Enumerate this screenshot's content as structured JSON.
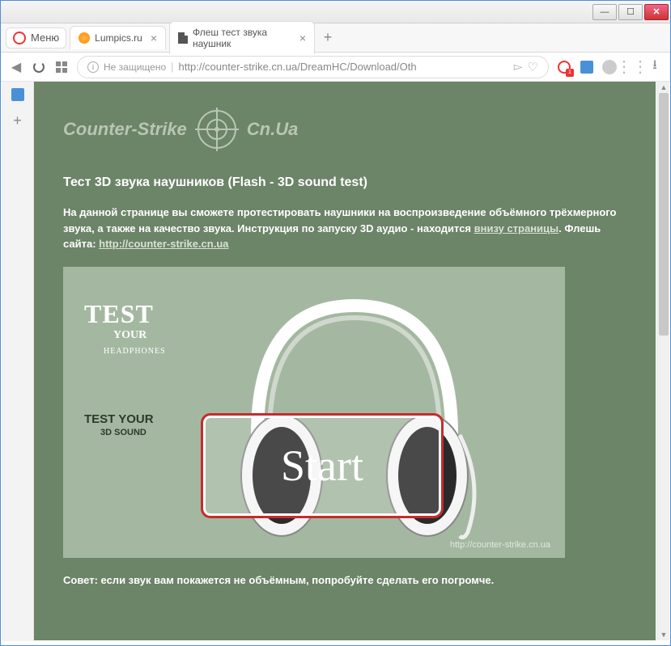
{
  "window": {
    "min": "—",
    "max": "☐",
    "close": "✕"
  },
  "browser": {
    "menu": "Меню",
    "tabs": [
      {
        "title": "Lumpics.ru",
        "favicon": "orange"
      },
      {
        "title": "Флеш тест звука наушник",
        "favicon": "doc"
      }
    ],
    "security_label": "Не защищено",
    "url": "http://counter-strike.cn.ua/DreamHC/Download/Oth",
    "chevron": "▻",
    "heart": "♡",
    "ext_badge": "1"
  },
  "page": {
    "logo_left": "Counter-Strike",
    "logo_right": "Cn.Ua",
    "heading": "Тест 3D звука наушников (Flash - 3D sound test)",
    "intro_1": "На данной странице вы сможете протестировать наушники на воспроизведение объёмного трёхмерного звука, а также на качество звука. Инструкция по запуску 3D аудио - находится ",
    "intro_link1": "внизу страницы",
    "intro_2": ". Флешь сайта: ",
    "intro_link2": "http://counter-strike.cn.ua",
    "flash": {
      "test": "TEST",
      "your": "YOUR",
      "headphones": "HEADPHONES",
      "test_your": "TEST YOUR",
      "sound3d": "3D SOUND",
      "start": "Start",
      "url": "http://counter-strike.cn.ua"
    },
    "tip_label": "Совет:",
    "tip_text": " если звук вам покажется не объёмным, попробуйте сделать его погромче."
  }
}
